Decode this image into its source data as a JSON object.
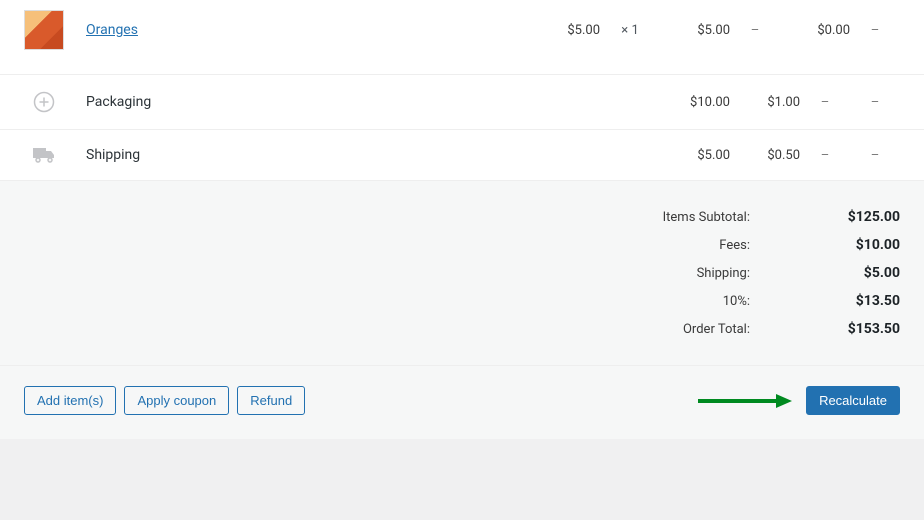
{
  "product_row": {
    "name": "Oranges",
    "cost": "$5.00",
    "qty_prefix": "×",
    "qty": "1",
    "total": "$5.00",
    "placeholder_dash": "–",
    "tax": "$0.00",
    "end_dash": "–"
  },
  "fee_row": {
    "name": "Packaging",
    "total": "$10.00",
    "tax": "$1.00",
    "dash1": "–",
    "dash2": "–"
  },
  "shipping_row": {
    "name": "Shipping",
    "total": "$5.00",
    "tax": "$0.50",
    "dash1": "–",
    "dash2": "–"
  },
  "totals": [
    {
      "label": "Items Subtotal:",
      "value": "$125.00"
    },
    {
      "label": "Fees:",
      "value": "$10.00"
    },
    {
      "label": "Shipping:",
      "value": "$5.00"
    },
    {
      "label": "10%:",
      "value": "$13.50"
    },
    {
      "label": "Order Total:",
      "value": "$153.50"
    }
  ],
  "buttons": {
    "add_items": "Add item(s)",
    "apply_coupon": "Apply coupon",
    "refund": "Refund",
    "recalculate": "Recalculate"
  },
  "annotation": {
    "arrow_color": "#008a20"
  }
}
